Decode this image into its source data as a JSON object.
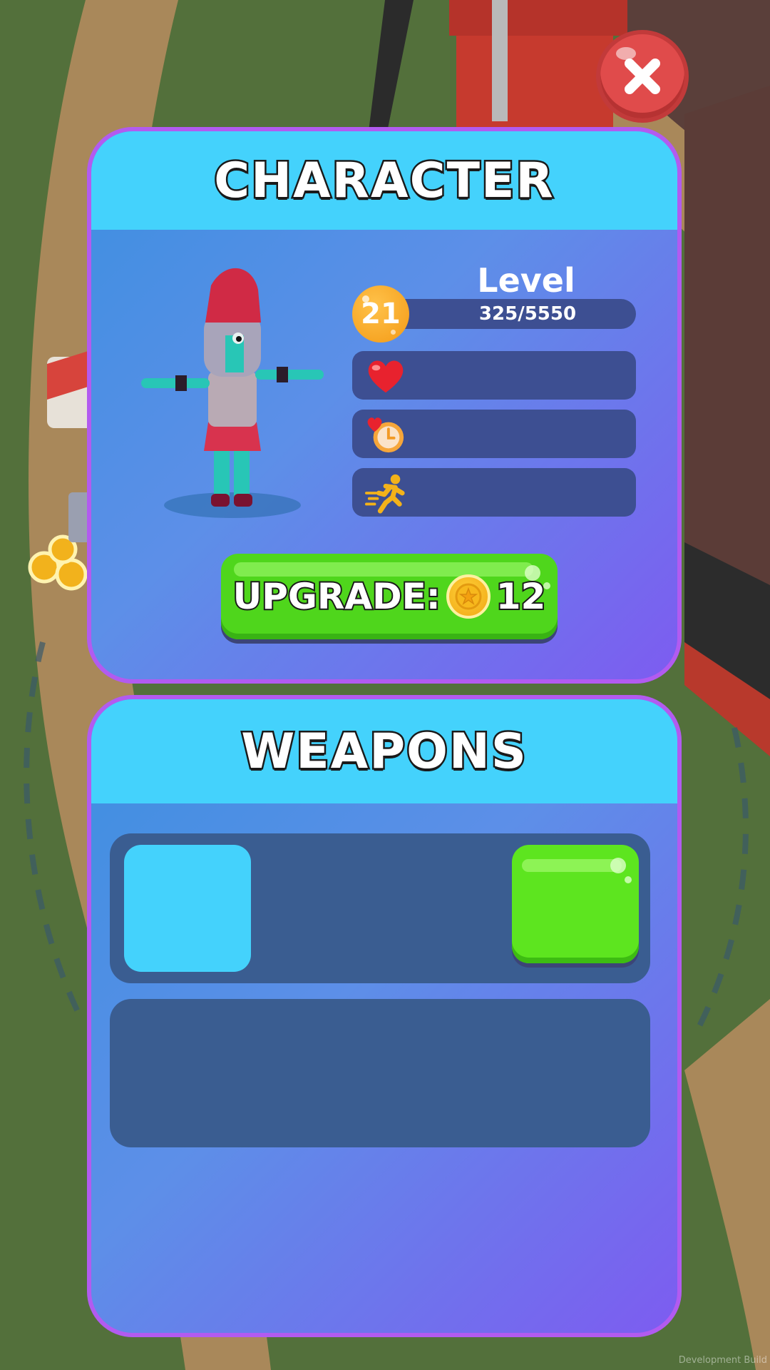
{
  "character_panel": {
    "title": "CHARACTER",
    "level_label": "Level",
    "level_number": "21",
    "xp_text": "325/5550",
    "xp_current": 325,
    "xp_max": 5550,
    "stats": [
      {
        "icon": "heart-icon"
      },
      {
        "icon": "heart-clock-icon"
      },
      {
        "icon": "running-man-icon"
      }
    ],
    "upgrade_label": "UPGRADE:",
    "upgrade_cost": "12",
    "upgrade_currency_icon": "coin-icon"
  },
  "weapons_panel": {
    "title": "WEAPONS"
  },
  "footer": {
    "build_label": "Development Build"
  },
  "colors": {
    "header": "#44d2fc",
    "panel_border": "#b25bf0",
    "button_green": "#4fd61c",
    "close_red": "#e04b4b",
    "stat_row": "#3d4f92"
  }
}
